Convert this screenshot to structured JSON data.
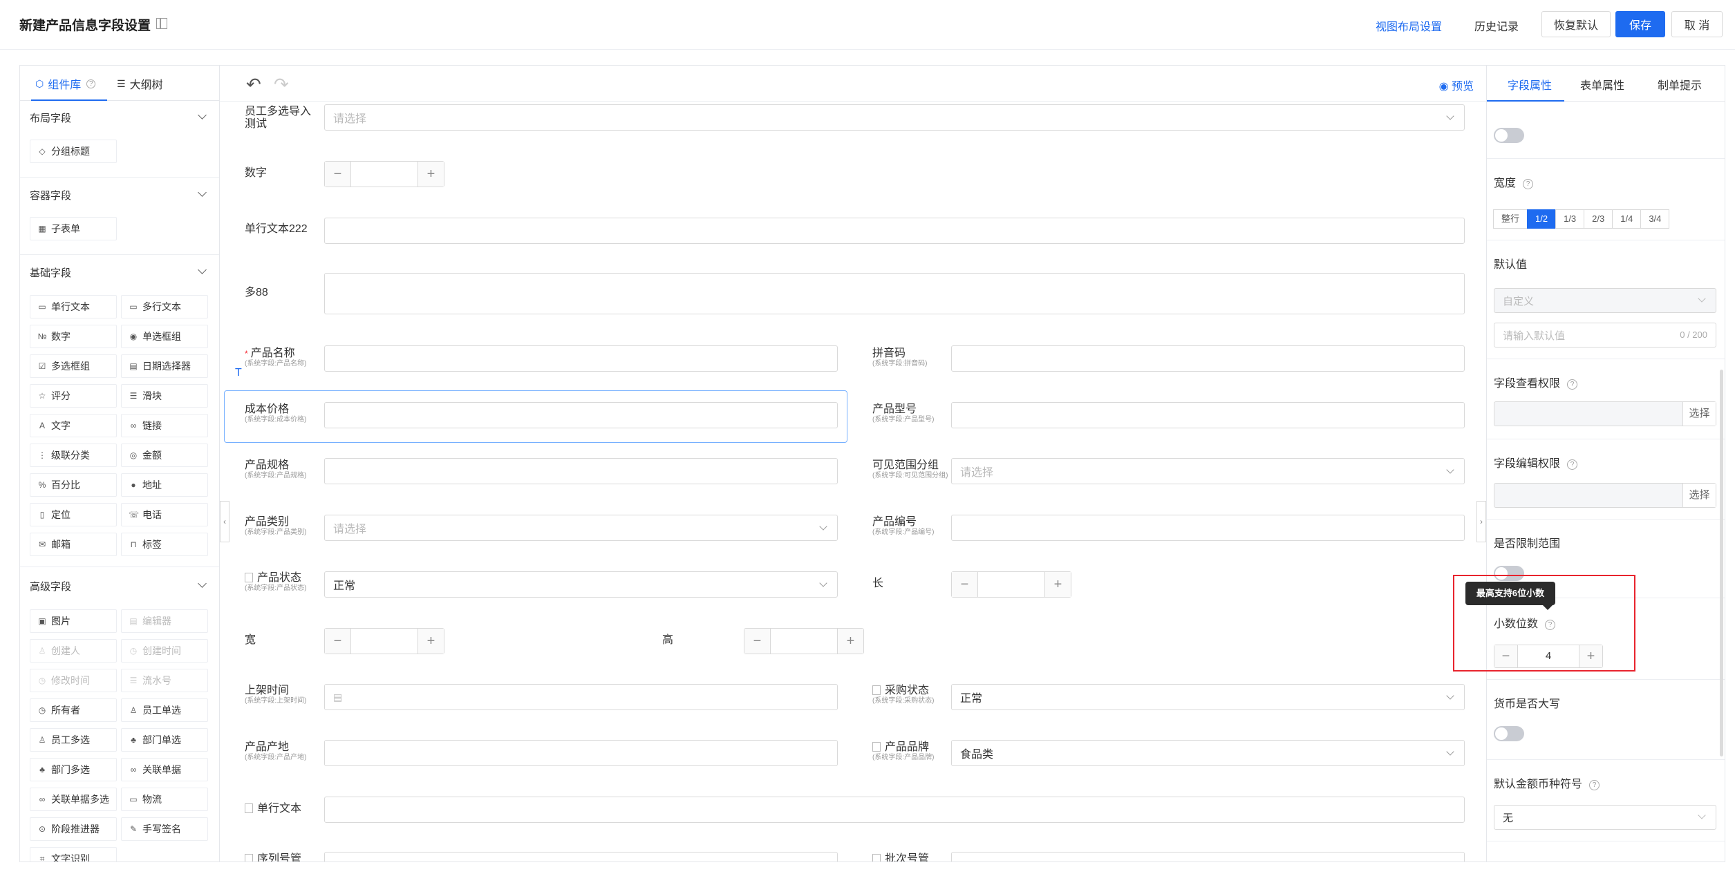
{
  "header": {
    "title": "新建产品信息字段设置",
    "view_layout": "视图布局设置",
    "history": "历史记录",
    "reset": "恢复默认",
    "save": "保存",
    "cancel": "取 消"
  },
  "left_panel": {
    "tabs": [
      "组件库",
      "大纲树"
    ],
    "groups": {
      "layout": "布局字段",
      "container": "容器字段",
      "basic": "基础字段",
      "advanced": "高级字段"
    },
    "layout_items": [
      "分组标题"
    ],
    "container_items": [
      "子表单"
    ],
    "basic_items": [
      "单行文本",
      "多行文本",
      "数字",
      "单选框组",
      "多选框组",
      "日期选择器",
      "评分",
      "滑块",
      "文字",
      "链接",
      "级联分类",
      "金额",
      "百分比",
      "地址",
      "定位",
      "电话",
      "邮箱",
      "标签"
    ],
    "advanced_items": [
      "图片",
      "编辑器",
      "创建人",
      "创建时间",
      "修改时间",
      "流水号",
      "所有者",
      "员工单选",
      "员工多选",
      "部门单选",
      "部门多选",
      "关联单据",
      "关联单据多选",
      "物流",
      "阶段推进器",
      "手写签名",
      "文字识别"
    ]
  },
  "canvas": {
    "preview": "预览",
    "text_marker": "T",
    "fields": {
      "emp_multi": {
        "label": "员工多选导入测试",
        "placeholder": "请选择"
      },
      "number": {
        "label": "数字"
      },
      "single_text": {
        "label": "单行文本222"
      },
      "multi88": {
        "label": "多88"
      },
      "product_name": {
        "label": "产品名称",
        "sub": "(系统字段:产品名称)"
      },
      "pinyin": {
        "label": "拼音码",
        "sub": "(系统字段:拼音码)"
      },
      "cost_price": {
        "label": "成本价格",
        "sub": "(系统字段:成本价格)"
      },
      "model": {
        "label": "产品型号",
        "sub": "(系统字段:产品型号)"
      },
      "spec": {
        "label": "产品规格",
        "sub": "(系统字段:产品规格)"
      },
      "visible_group": {
        "label": "可见范围分组",
        "sub": "(系统字段:可见范围分组)",
        "placeholder": "请选择"
      },
      "category": {
        "label": "产品类别",
        "sub": "(系统字段:产品类别)",
        "placeholder": "请选择"
      },
      "code": {
        "label": "产品编号",
        "sub": "(系统字段:产品编号)"
      },
      "status": {
        "label": "产品状态",
        "sub": "(系统字段:产品状态)",
        "value": "正常"
      },
      "length": {
        "label": "长"
      },
      "width": {
        "label": "宽"
      },
      "height": {
        "label": "高"
      },
      "shelf_time": {
        "label": "上架时间",
        "sub": "(系统字段:上架时间)"
      },
      "purchase_status": {
        "label": "采购状态",
        "sub": "(系统字段:采购状态)",
        "value": "正常"
      },
      "origin": {
        "label": "产品产地",
        "sub": "(系统字段:产品产地)"
      },
      "brand": {
        "label": "产品品牌",
        "sub": "(系统字段:产品品牌)",
        "value": "食品类"
      },
      "single_text2": {
        "label": "单行文本"
      },
      "serial": {
        "label": "序列号管"
      },
      "batch": {
        "label": "批次号管"
      }
    }
  },
  "right_panel": {
    "tabs": [
      "字段属性",
      "表单属性",
      "制单提示"
    ],
    "width_label": "宽度",
    "width_options": [
      "整行",
      "1/2",
      "1/3",
      "2/3",
      "1/4",
      "3/4"
    ],
    "width_selected": "1/2",
    "default_value_label": "默认值",
    "default_mode": "自定义",
    "default_placeholder": "请输入默认值",
    "default_counter": "0 / 200",
    "view_perm_label": "字段查看权限",
    "edit_perm_label": "字段编辑权限",
    "select_label": "选择",
    "limit_range_label": "是否限制范围",
    "decimal_label": "小数位数",
    "decimal_value": "4",
    "tooltip": "最高支持6位小数",
    "currency_upper_label": "货币是否大写",
    "currency_symbol_label": "默认金额币种符号",
    "currency_symbol_value": "无"
  },
  "colors": {
    "accent": "#1e6bf0",
    "highlight": "#e8232d"
  }
}
